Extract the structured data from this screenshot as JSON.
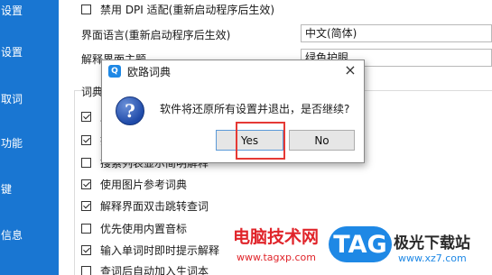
{
  "sidebar": {
    "items": [
      {
        "label": "设置"
      },
      {
        "label": "设置"
      },
      {
        "label": "取词"
      },
      {
        "label": "功能"
      },
      {
        "label": "键"
      },
      {
        "label": "信息"
      }
    ]
  },
  "settings": {
    "disable_dpi": {
      "label": "禁用 DPI 适配(重新启动程序后生效)",
      "checked": false
    },
    "ui_language": {
      "label": "界面语言(重新启动程序后生效)",
      "value": "中文(简体)"
    },
    "theme": {
      "label": "解释界面主题",
      "value": "绿色护眼"
    },
    "group_title": "词典",
    "options": [
      {
        "label": "显",
        "checked": true
      },
      {
        "label": "搜",
        "checked": true
      },
      {
        "label": "搜索列表显示简明解释",
        "checked": false
      },
      {
        "label": "使用图片参考词典",
        "checked": true
      },
      {
        "label": "解释界面双击跳转查词",
        "checked": true
      },
      {
        "label": "优先使用内置音标",
        "checked": false
      },
      {
        "label": "输入单词时即时提示解释",
        "checked": true
      },
      {
        "label": "查词后自动加入生词本",
        "checked": false
      }
    ]
  },
  "dialog": {
    "title": "欧路词典",
    "message": "软件将还原所有设置并退出，是否继续?",
    "yes_label": "Yes",
    "no_label": "No",
    "close_symbol": "×",
    "question_symbol": "?"
  },
  "watermark": {
    "brand_text": "电脑技术网",
    "brand_url": "www.tagxp.com",
    "logo_text": "TAG",
    "site_text": "极光下载站",
    "site_url": "www.xz7.com"
  },
  "colors": {
    "sidebar": "#1976d2",
    "highlight": "#e53935",
    "watermark_red": "#e0242a"
  }
}
